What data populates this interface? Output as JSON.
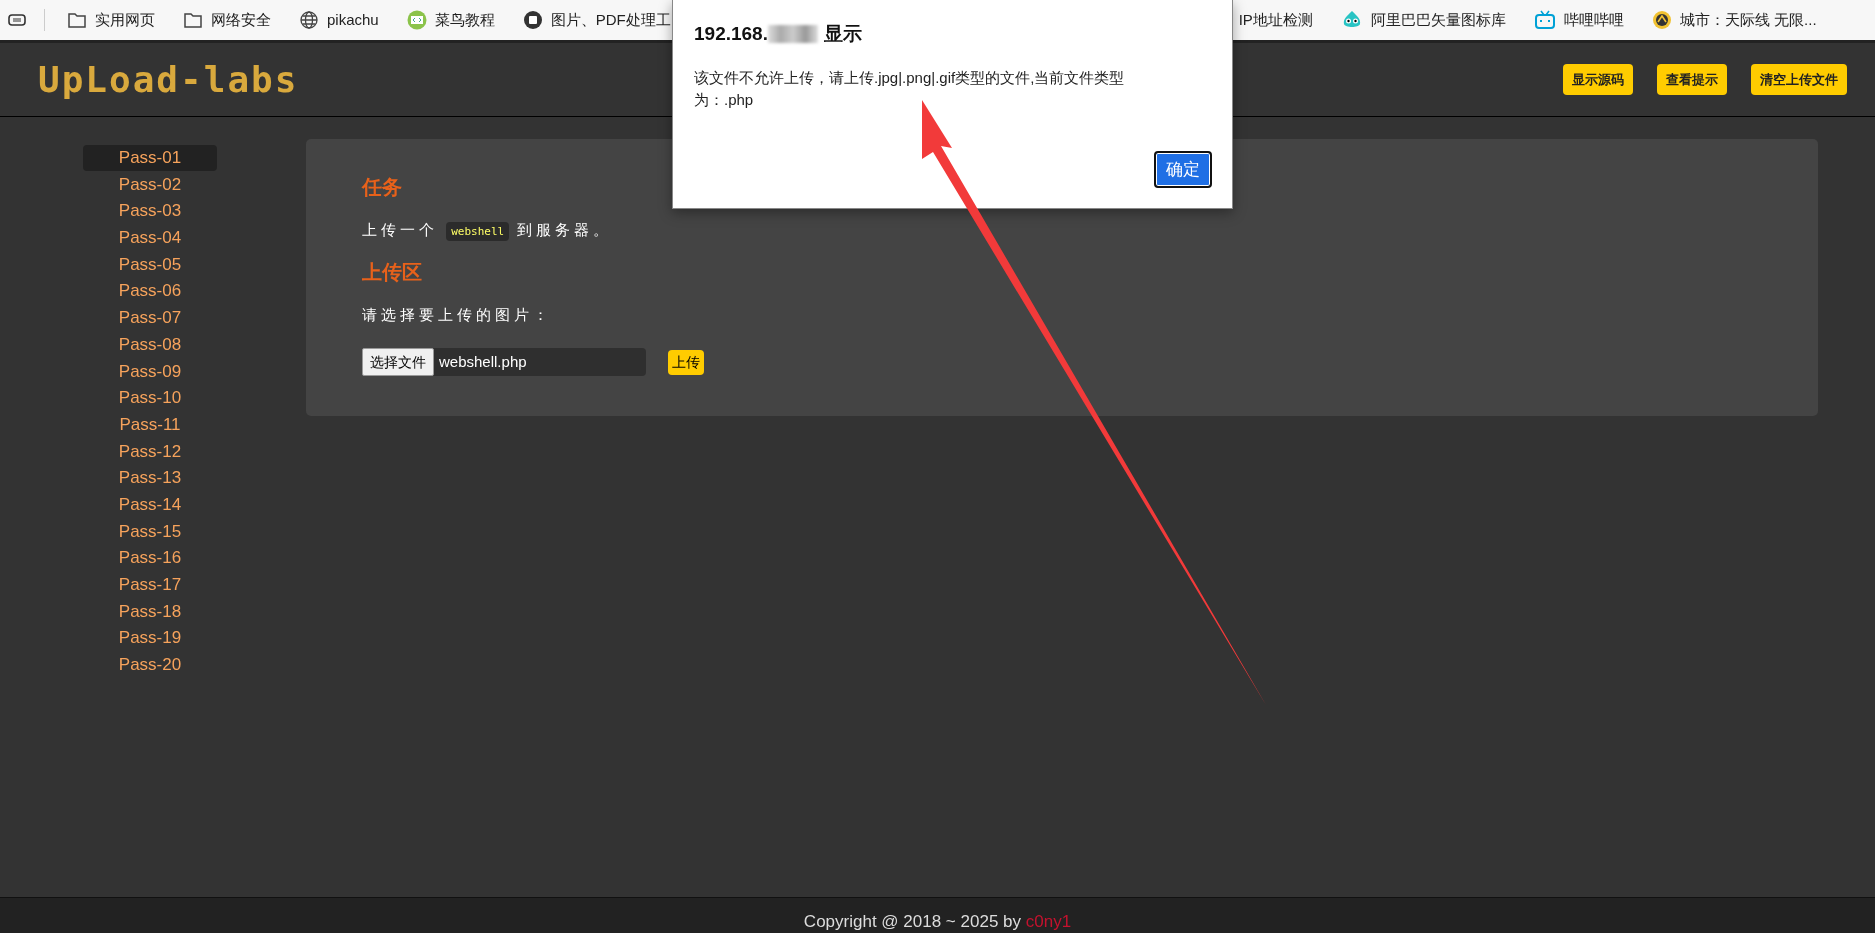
{
  "bookmarks_bar": {
    "items": [
      {
        "label": "实用网页"
      },
      {
        "label": "网络安全"
      },
      {
        "label": "pikachu"
      },
      {
        "label": "菜鸟教程"
      },
      {
        "label": "图片、PDF处理工"
      },
      {
        "label": "IP地址检测"
      },
      {
        "label": "阿里巴巴矢量图标库"
      },
      {
        "label": "哔哩哔哩"
      },
      {
        "label": "城市：天际线 无限..."
      }
    ]
  },
  "header": {
    "logo": "UpLoad-labs",
    "buttons": [
      "显示源码",
      "查看提示",
      "清空上传文件"
    ]
  },
  "sidebar": {
    "items": [
      {
        "label": "Pass-01",
        "selected": true
      },
      {
        "label": "Pass-02",
        "selected": false
      },
      {
        "label": "Pass-03",
        "selected": false
      },
      {
        "label": "Pass-04",
        "selected": false
      },
      {
        "label": "Pass-05",
        "selected": false
      },
      {
        "label": "Pass-06",
        "selected": false
      },
      {
        "label": "Pass-07",
        "selected": false
      },
      {
        "label": "Pass-08",
        "selected": false
      },
      {
        "label": "Pass-09",
        "selected": false
      },
      {
        "label": "Pass-10",
        "selected": false
      },
      {
        "label": "Pass-11",
        "selected": false
      },
      {
        "label": "Pass-12",
        "selected": false
      },
      {
        "label": "Pass-13",
        "selected": false
      },
      {
        "label": "Pass-14",
        "selected": false
      },
      {
        "label": "Pass-15",
        "selected": false
      },
      {
        "label": "Pass-16",
        "selected": false
      },
      {
        "label": "Pass-17",
        "selected": false
      },
      {
        "label": "Pass-18",
        "selected": false
      },
      {
        "label": "Pass-19",
        "selected": false
      },
      {
        "label": "Pass-20",
        "selected": false
      }
    ]
  },
  "task": {
    "heading": "任务",
    "text_before": "上传一个",
    "code": "webshell",
    "text_after": "到服务器。"
  },
  "upload": {
    "heading": "上传区",
    "prompt": "请选择要上传的图片：",
    "choose_button": "选择文件",
    "file_name": "webshell.php",
    "submit_button": "上传"
  },
  "footer": {
    "text": "Copyright @ 2018 ~ 2025 by",
    "author": "c0ny1"
  },
  "dialog": {
    "title_prefix": "192.168.",
    "title_redacted": true,
    "title_suffix": "显示",
    "message": "该文件不允许上传，请上传.jpg|.png|.gif类型的文件,当前文件类型为：.php",
    "ok_button": "确定"
  },
  "annotation": {
    "kind": "arrow"
  }
}
